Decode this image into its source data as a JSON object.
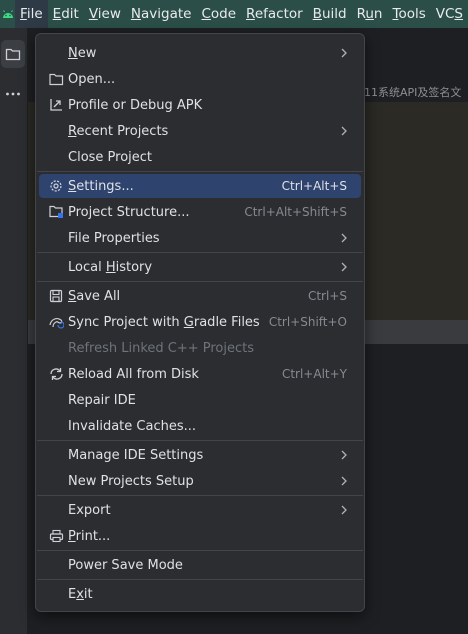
{
  "menubar": {
    "items": [
      {
        "label": "File",
        "mnemonic": "F"
      },
      {
        "label": "Edit",
        "mnemonic": "E"
      },
      {
        "label": "View",
        "mnemonic": "V"
      },
      {
        "label": "Navigate",
        "mnemonic": "N"
      },
      {
        "label": "Code",
        "mnemonic": "C"
      },
      {
        "label": "Refactor",
        "mnemonic": "R"
      },
      {
        "label": "Build",
        "mnemonic": "B"
      },
      {
        "label": "Run",
        "mnemonic": "u"
      },
      {
        "label": "Tools",
        "mnemonic": "T"
      },
      {
        "label": "VCS",
        "mnemonic": "S"
      }
    ]
  },
  "editor": {
    "tab_text": "11系统API及签名文"
  },
  "file_menu": {
    "new": "New",
    "open": "Open...",
    "profile_debug_apk": "Profile or Debug APK",
    "recent_projects": "Recent Projects",
    "close_project": "Close Project",
    "settings": "Settings...",
    "settings_shortcut": "Ctrl+Alt+S",
    "project_structure": "Project Structure...",
    "project_structure_shortcut": "Ctrl+Alt+Shift+S",
    "file_properties": "File Properties",
    "local_history": "Local History",
    "save_all": "Save All",
    "save_all_shortcut": "Ctrl+S",
    "sync_gradle": "Sync Project with Gradle Files",
    "sync_gradle_shortcut": "Ctrl+Shift+O",
    "refresh_cpp": "Refresh Linked C++ Projects",
    "reload_disk": "Reload All from Disk",
    "reload_disk_shortcut": "Ctrl+Alt+Y",
    "repair_ide": "Repair IDE",
    "invalidate_caches": "Invalidate Caches...",
    "manage_ide_settings": "Manage IDE Settings",
    "new_projects_setup": "New Projects Setup",
    "export": "Export",
    "print": "Print...",
    "power_save": "Power Save Mode",
    "exit": "Exit"
  },
  "colors": {
    "titlebar": "#2b4f48",
    "menu_bg": "#2b2d30",
    "selection": "#2e436e",
    "android_green": "#3ddc84"
  },
  "icons": [
    "android-logo-icon",
    "folder-icon",
    "more-icon",
    "open-folder-icon",
    "profile-apk-icon",
    "gear-icon",
    "project-structure-icon",
    "save-icon",
    "sync-gradle-icon",
    "reload-icon",
    "printer-icon",
    "chevron-right-icon"
  ]
}
